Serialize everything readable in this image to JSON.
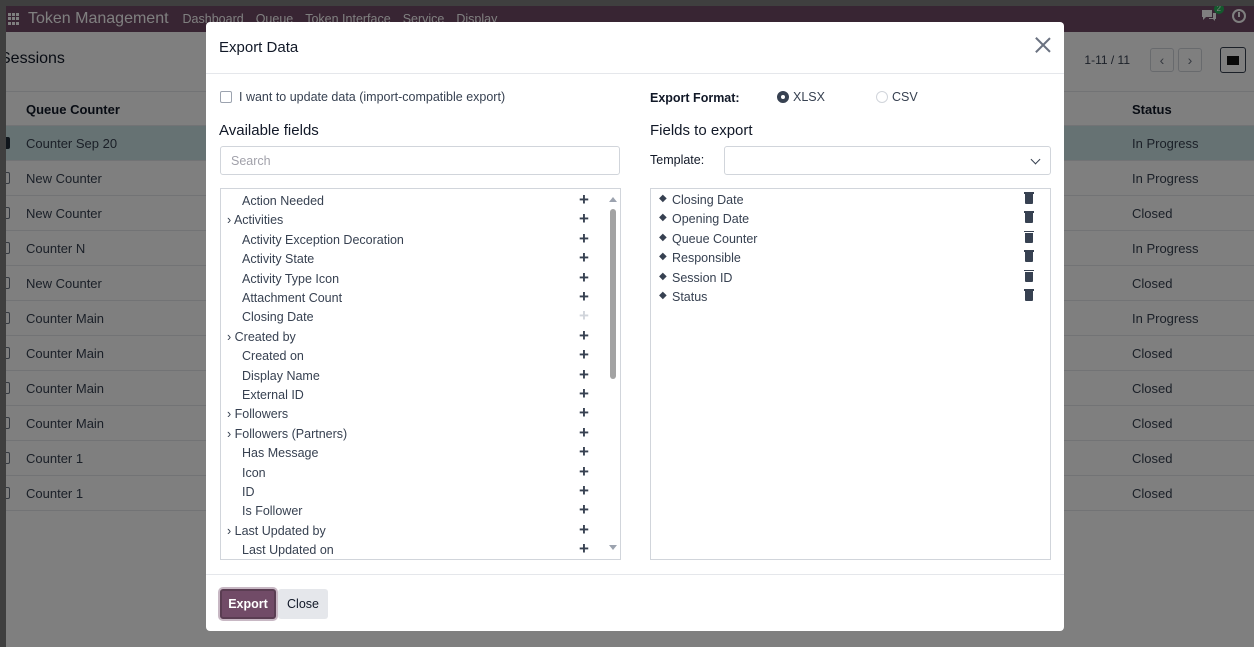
{
  "app": {
    "brand": "Token Management",
    "menus": [
      "Dashboard",
      "Queue",
      "Token Interface",
      "Service",
      "Display"
    ],
    "chat_badge": "2"
  },
  "control_panel": {
    "breadcrumb": "Sessions",
    "pager": "1-11 / 11",
    "prev_icon": "chevron-left-icon",
    "next_icon": "chevron-right-icon"
  },
  "list": {
    "headers": {
      "queue_counter": "Queue Counter",
      "status": "Status"
    },
    "rows": [
      {
        "counter": "Counter Sep 20",
        "status": "In Progress",
        "selected": true
      },
      {
        "counter": "New Counter",
        "status": "In Progress"
      },
      {
        "counter": "New Counter",
        "status": "Closed"
      },
      {
        "counter": "Counter N",
        "status": "In Progress"
      },
      {
        "counter": "New Counter",
        "status": "Closed"
      },
      {
        "counter": "Counter Main",
        "status": "In Progress"
      },
      {
        "counter": "Counter Main",
        "status": "Closed"
      },
      {
        "counter": "Counter Main",
        "status": "Closed"
      },
      {
        "counter": "Counter Main",
        "status": "Closed"
      },
      {
        "counter": "Counter 1",
        "status": "Closed"
      },
      {
        "counter": "Counter 1",
        "status": "Closed"
      }
    ]
  },
  "modal": {
    "title": "Export Data",
    "import_compat_label": "I want to update data (import-compatible export)",
    "available_title": "Available fields",
    "search_placeholder": "Search",
    "available_fields": [
      {
        "label": "Action Needed",
        "expandable": false
      },
      {
        "label": "Activities",
        "expandable": true
      },
      {
        "label": "Activity Exception Decoration",
        "expandable": false
      },
      {
        "label": "Activity State",
        "expandable": false
      },
      {
        "label": "Activity Type Icon",
        "expandable": false
      },
      {
        "label": "Attachment Count",
        "expandable": false
      },
      {
        "label": "Closing Date",
        "expandable": false,
        "added": true
      },
      {
        "label": "Created by",
        "expandable": true
      },
      {
        "label": "Created on",
        "expandable": false
      },
      {
        "label": "Display Name",
        "expandable": false
      },
      {
        "label": "External ID",
        "expandable": false
      },
      {
        "label": "Followers",
        "expandable": true
      },
      {
        "label": "Followers (Partners)",
        "expandable": true
      },
      {
        "label": "Has Message",
        "expandable": false
      },
      {
        "label": "Icon",
        "expandable": false
      },
      {
        "label": "ID",
        "expandable": false
      },
      {
        "label": "Is Follower",
        "expandable": false
      },
      {
        "label": "Last Updated by",
        "expandable": true
      },
      {
        "label": "Last Updated on",
        "expandable": false
      }
    ],
    "export_format_label": "Export Format:",
    "formats": [
      {
        "label": "XLSX",
        "selected": true
      },
      {
        "label": "CSV",
        "selected": false
      }
    ],
    "fields_to_export_title": "Fields to export",
    "template_label": "Template:",
    "template_value": "",
    "export_fields": [
      "Closing Date",
      "Opening Date",
      "Queue Counter",
      "Responsible",
      "Session ID",
      "Status"
    ],
    "export_button": "Export",
    "close_button": "Close"
  }
}
